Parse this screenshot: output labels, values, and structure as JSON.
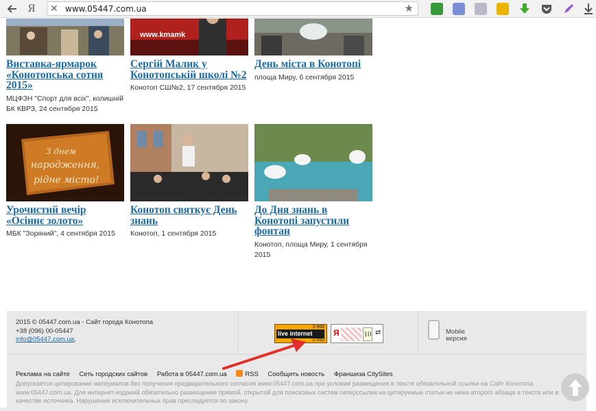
{
  "browser": {
    "back_icon": "arrow-left-icon",
    "yandex_label": "Я",
    "url": "www.05447.com.ua"
  },
  "cards": [
    {
      "title": "Виставка-ярмарок «Конотопська сотня 2015»",
      "meta": "МЦФЗН \"Спорт для всіх\", колишній БК КВРЗ, 24 сентября 2015"
    },
    {
      "title": "Сергій Малик у Конотопській школі №2",
      "meta": "Конотоп СШ№2, 17 сентября 2015"
    },
    {
      "title": "День міста в Конотопі",
      "meta": "площа Миру, 6 сентября 2015"
    },
    {
      "title": "Урочистий вечір «Осіннє золото»",
      "meta": "МБК \"Зоряний\", 4 сентября 2015"
    },
    {
      "title": "Конотоп святкує День знань",
      "meta": "Конотоп, 1 сентября 2015"
    },
    {
      "title": "До Дня знань в Конотопі запустили фонтан",
      "meta": "Конотоп, площа Миру, 1 сентября 2015"
    }
  ],
  "thumb_texts": {
    "kmamk": "www.kmamk",
    "stage_line1": "З днем",
    "stage_line2": "народження,",
    "stage_line3": "рідне місто!"
  },
  "footer": {
    "copyright": "2015 © 05447.com.ua - Сайт города Конотопа",
    "phone": "+38 (096) 00-05447",
    "email": "info@05447.com.ua",
    "email_suffix": ",",
    "counter1_top": "3 968",
    "counter1_label": "live internet",
    "counter1_bottom": "2 050",
    "counter2_ya": "Я",
    "counter2_value": "10",
    "counter2_refresh": "⇄",
    "mobile_line1": "Mobile",
    "mobile_line2": "версия",
    "links": [
      "Реклама на сайте",
      "Сеть городских сайтов",
      "Работа в 05447.com.ua",
      "RSS",
      "Сообщить новость",
      "Франшиза CitySites"
    ],
    "disclaimer": "Допускается цитирование материалов без получения предварительного согласия www.05447.com.ua при условии размещения в тексте обязательной ссылки на Сайт Конотопа www.05447.com.ua. Для интернет-изданий обязательно размещение прямой, открытой для поисковых систем гиперссылки на цитируемые статьи не ниже второго абзаца в тексте или в качестве источника. Нарушение исключительных прав преследуется по закону."
  },
  "colors": {
    "link": "#1a6aa5",
    "footer_bg": "#e9e9e9",
    "arrow": "#e2302a",
    "counter_orange": "#f6a800"
  }
}
